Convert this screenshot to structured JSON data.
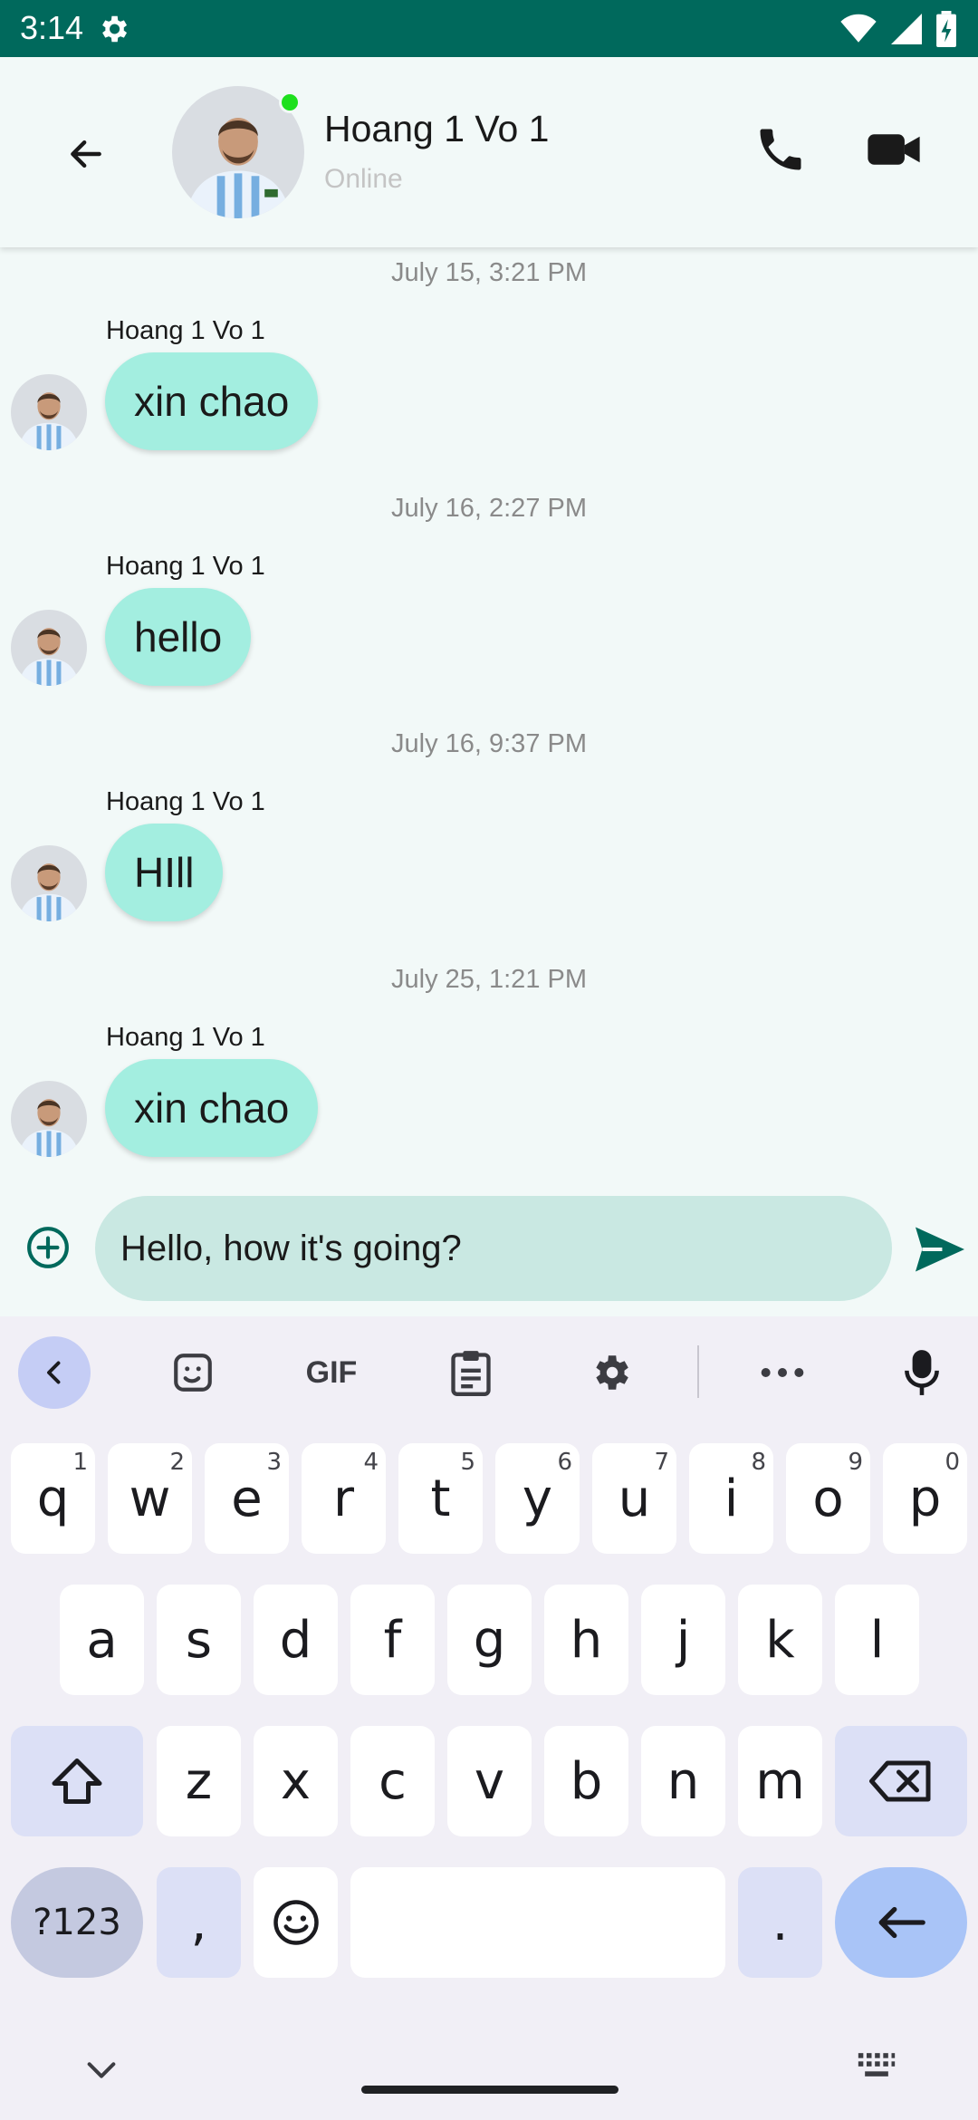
{
  "status_bar": {
    "time": "3:14",
    "icons": [
      "gear-icon",
      "wifi-icon",
      "signal-icon",
      "battery-charging-icon"
    ]
  },
  "header": {
    "contact_name": "Hoang 1 Vo 1",
    "status": "Online",
    "online_color": "#1ee01e"
  },
  "messages": [
    {
      "timestamp": "July 15, 3:21 PM",
      "sender": "Hoang 1 Vo 1",
      "text": "xin chao"
    },
    {
      "timestamp": "July 16, 2:27 PM",
      "sender": "Hoang 1 Vo 1",
      "text": "hello"
    },
    {
      "timestamp": "July 16, 9:37 PM",
      "sender": "Hoang 1 Vo 1",
      "text": "HIll"
    },
    {
      "timestamp": "July 25, 1:21 PM",
      "sender": "Hoang 1 Vo 1",
      "text": "xin chao"
    }
  ],
  "composer": {
    "value": "Hello, how it's going?"
  },
  "keyboard": {
    "toolbar": {
      "gif_label": "GIF"
    },
    "row1": [
      {
        "k": "q",
        "h": "1"
      },
      {
        "k": "w",
        "h": "2"
      },
      {
        "k": "e",
        "h": "3"
      },
      {
        "k": "r",
        "h": "4"
      },
      {
        "k": "t",
        "h": "5"
      },
      {
        "k": "y",
        "h": "6"
      },
      {
        "k": "u",
        "h": "7"
      },
      {
        "k": "i",
        "h": "8"
      },
      {
        "k": "o",
        "h": "9"
      },
      {
        "k": "p",
        "h": "0"
      }
    ],
    "row2": [
      "a",
      "s",
      "d",
      "f",
      "g",
      "h",
      "j",
      "k",
      "l"
    ],
    "row3": [
      "z",
      "x",
      "c",
      "v",
      "b",
      "n",
      "m"
    ],
    "symbols_label": "?123",
    "comma_label": ",",
    "period_label": "."
  },
  "colors": {
    "status_bar": "#00695c",
    "bubble": "#a3eee0",
    "composer_input": "#c9e8e2",
    "send_accent": "#00695c"
  }
}
